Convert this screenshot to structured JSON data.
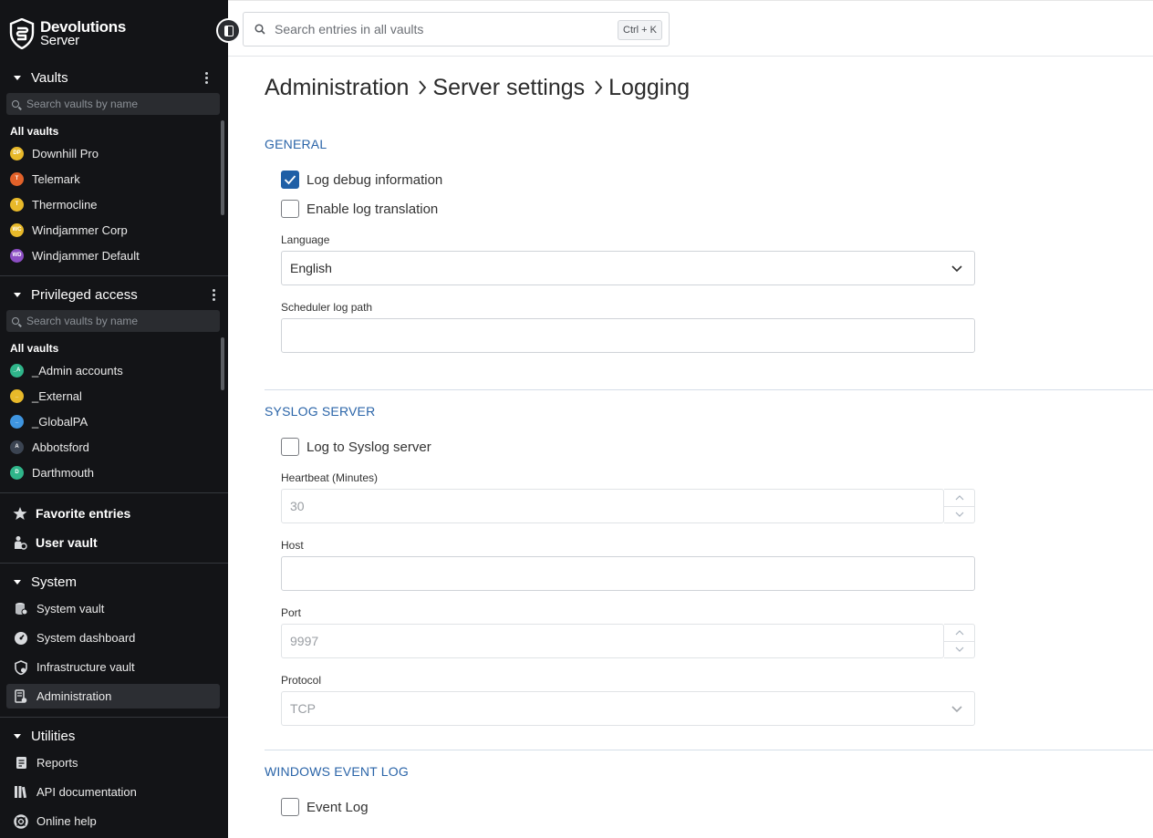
{
  "brand": {
    "line1": "Devolutions",
    "line2": "Server"
  },
  "vaults": {
    "title": "Vaults",
    "search_placeholder": "Search vaults by name",
    "all_label": "All vaults",
    "items": [
      {
        "initials": "DP",
        "label": "Downhill Pro",
        "color": "#e8b92a"
      },
      {
        "initials": "T",
        "label": "Telemark",
        "color": "#e2622a"
      },
      {
        "initials": "T",
        "label": "Thermocline",
        "color": "#e8b92a"
      },
      {
        "initials": "WC",
        "label": "Windjammer Corp",
        "color": "#e8b92a"
      },
      {
        "initials": "WD",
        "label": "Windjammer Default",
        "color": "#8c4ec4"
      }
    ]
  },
  "privileged": {
    "title": "Privileged access",
    "search_placeholder": "Search vaults by name",
    "all_label": "All vaults",
    "items": [
      {
        "initials": "_A",
        "label": "_Admin accounts",
        "color": "#2fb58a"
      },
      {
        "initials": "_",
        "label": "_External",
        "color": "#e8b92a"
      },
      {
        "initials": "_",
        "label": "_GlobalPA",
        "color": "#3f95e0"
      },
      {
        "initials": "A",
        "label": "Abbotsford",
        "color": "#3b4452"
      },
      {
        "initials": "D",
        "label": "Darthmouth",
        "color": "#2fb58a"
      }
    ]
  },
  "quick": {
    "favorites": "Favorite entries",
    "user_vault": "User vault"
  },
  "system": {
    "title": "System",
    "items": [
      "System vault",
      "System dashboard",
      "Infrastructure vault",
      "Administration"
    ]
  },
  "utilities": {
    "title": "Utilities",
    "items": [
      "Reports",
      "API documentation",
      "Online help"
    ]
  },
  "search": {
    "placeholder": "Search entries in all vaults",
    "shortcut": "Ctrl + K"
  },
  "breadcrumb": [
    "Administration",
    "Server settings",
    "Logging"
  ],
  "general": {
    "title": "GENERAL",
    "log_debug": {
      "label": "Log debug information",
      "checked": true
    },
    "log_translation": {
      "label": "Enable log translation",
      "checked": false
    },
    "language_label": "Language",
    "language_value": "English",
    "scheduler_label": "Scheduler log path",
    "scheduler_value": ""
  },
  "syslog": {
    "title": "SYSLOG SERVER",
    "log_to_syslog": {
      "label": "Log to Syslog server",
      "checked": false
    },
    "heartbeat_label": "Heartbeat (Minutes)",
    "heartbeat_value": "30",
    "host_label": "Host",
    "host_value": "",
    "port_label": "Port",
    "port_value": "9997",
    "protocol_label": "Protocol",
    "protocol_value": "TCP"
  },
  "event_log": {
    "title": "WINDOWS EVENT LOG",
    "event_log": {
      "label": "Event Log",
      "checked": false
    }
  }
}
